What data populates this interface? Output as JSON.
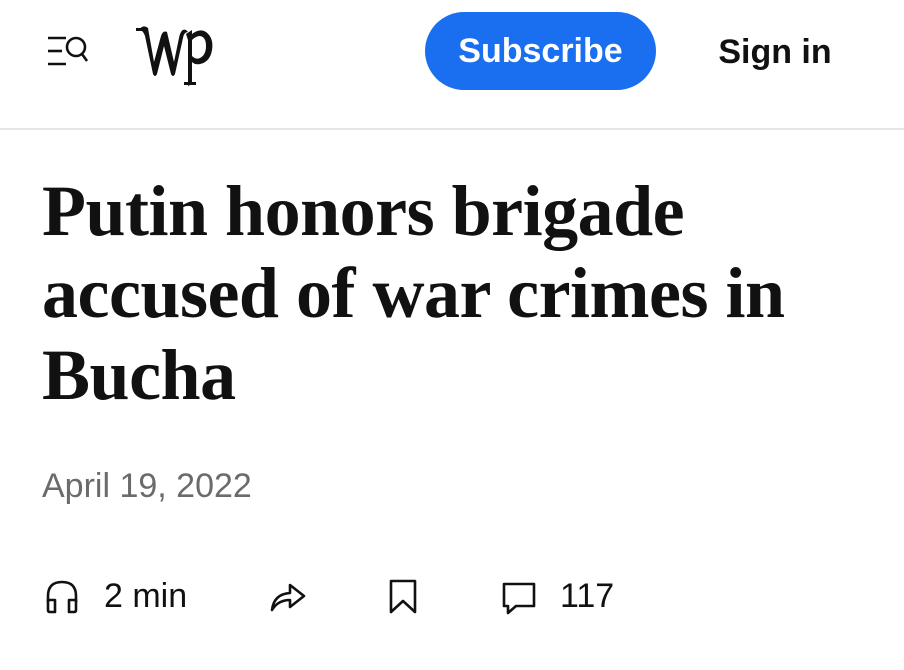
{
  "header": {
    "menu_icon": "menu-search-icon",
    "logo_text": "wp",
    "subscribe_label": "Subscribe",
    "signin_label": "Sign in",
    "subscribe_color": "#1a6ef0"
  },
  "article": {
    "headline": "Putin honors brigade accused of war crimes in Bucha",
    "date": "April 19, 2022"
  },
  "actions": {
    "listen_icon": "headphones-icon",
    "listen_label": "2 min",
    "share_icon": "share-icon",
    "save_icon": "bookmark-icon",
    "comments_icon": "comment-icon",
    "comments_count": "117"
  }
}
